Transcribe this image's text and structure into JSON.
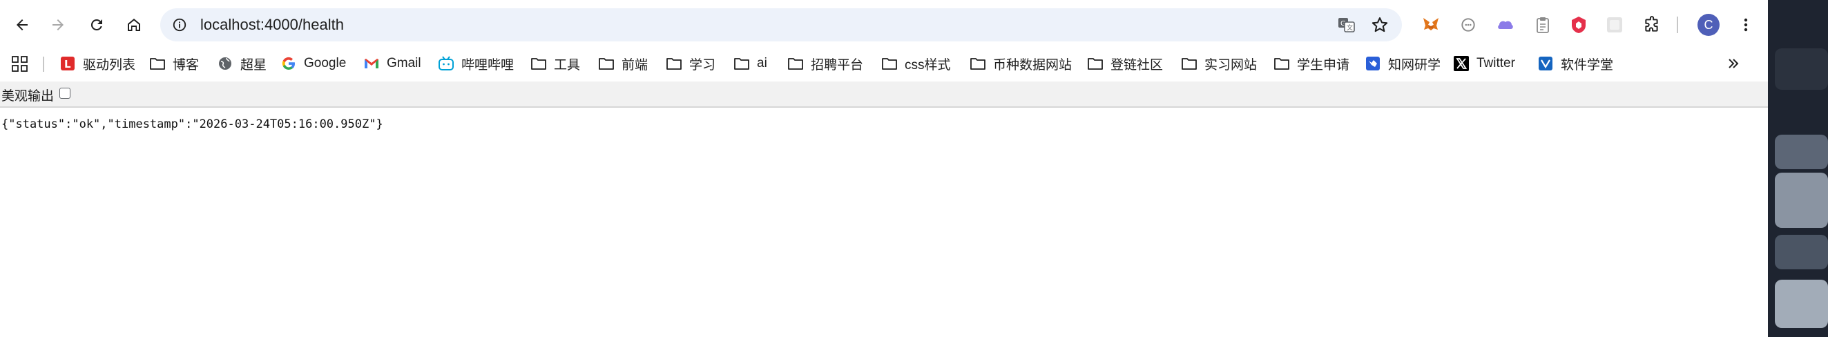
{
  "toolbar": {
    "url": "localhost:4000/health"
  },
  "profile": {
    "initial": "C"
  },
  "bookmarks": [
    {
      "label": "驱动列表",
      "icon": "red-l-icon"
    },
    {
      "label": "博客",
      "icon": "folder-icon"
    },
    {
      "label": "超星",
      "icon": "globe-icon"
    },
    {
      "label": "Google",
      "icon": "google-icon"
    },
    {
      "label": "Gmail",
      "icon": "gmail-icon"
    },
    {
      "label": "哔哩哔哩",
      "icon": "bilibili-icon"
    },
    {
      "label": "工具",
      "icon": "folder-icon"
    },
    {
      "label": "前端",
      "icon": "folder-icon"
    },
    {
      "label": "学习",
      "icon": "folder-icon"
    },
    {
      "label": "ai",
      "icon": "folder-icon"
    },
    {
      "label": "招聘平台",
      "icon": "folder-icon"
    },
    {
      "label": "css样式",
      "icon": "folder-icon"
    },
    {
      "label": "币种数据网站",
      "icon": "folder-icon"
    },
    {
      "label": "登链社区",
      "icon": "folder-icon"
    },
    {
      "label": "实习网站",
      "icon": "folder-icon"
    },
    {
      "label": "学生申请",
      "icon": "folder-icon"
    },
    {
      "label": "知网研学",
      "icon": "cnki-icon"
    },
    {
      "label": "Twitter",
      "icon": "x-icon"
    },
    {
      "label": "软件学堂",
      "icon": "software-icon"
    }
  ],
  "pretty_print": {
    "label": "美观输出",
    "checked": false
  },
  "content": {
    "json_text": "{\"status\":\"ok\",\"timestamp\":\"2026-03-24T05:16:00.950Z\"}"
  },
  "colors": {
    "omnibox_bg": "#edf2fa",
    "avatar_bg": "#4f5fb8",
    "pretty_bar_bg": "#f1f1f1"
  }
}
